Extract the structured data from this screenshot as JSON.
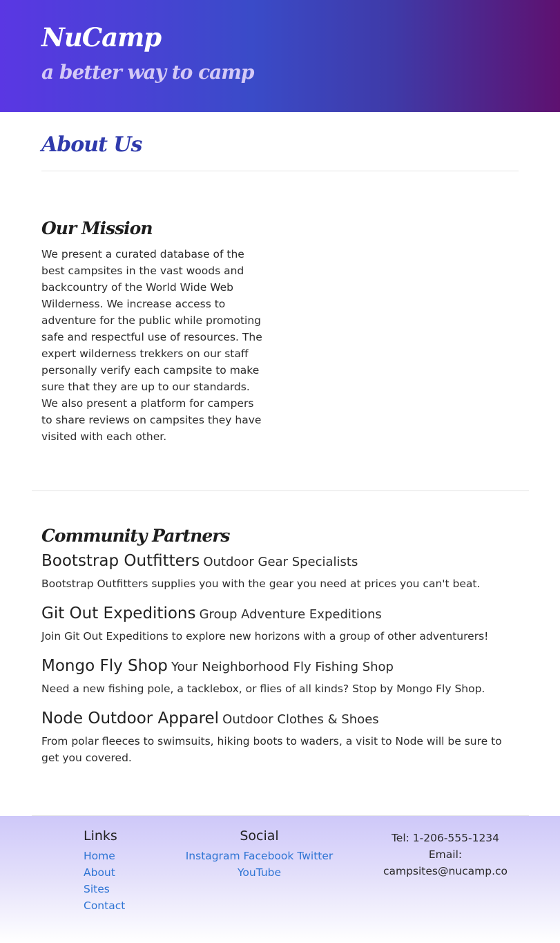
{
  "header": {
    "brand": "NuCamp",
    "tagline": "a better way to camp"
  },
  "main": {
    "title": "About Us",
    "mission": {
      "heading": "Our Mission",
      "text": "We present a curated database of the best campsites in the vast woods and backcountry of the World Wide Web Wilderness. We increase access to adventure for the public while promoting safe and respectful use of resources. The expert wilderness trekkers on our staff personally verify each campsite to make sure that they are up to our standards. We also present a platform for campers to share reviews on campsites they have visited with each other."
    },
    "partners": {
      "heading": "Community Partners",
      "items": [
        {
          "name": "Bootstrap Outfitters",
          "tagline": "Outdoor Gear Specialists",
          "description": "Bootstrap Outfitters supplies you with the gear you need at prices you can't beat."
        },
        {
          "name": "Git Out Expeditions",
          "tagline": "Group Adventure Expeditions",
          "description": "Join Git Out Expeditions to explore new horizons with a group of other adventurers!"
        },
        {
          "name": "Mongo Fly Shop",
          "tagline": "Your Neighborhood Fly Fishing Shop",
          "description": "Need a new fishing pole, a tacklebox, or flies of all kinds? Stop by Mongo Fly Shop."
        },
        {
          "name": "Node Outdoor Apparel",
          "tagline": "Outdoor Clothes & Shoes",
          "description": "From polar fleeces to swimsuits, hiking boots to waders, a visit to Node will be sure to get you covered."
        }
      ]
    }
  },
  "footer": {
    "links": {
      "heading": "Links",
      "items": [
        "Home",
        "About",
        "Sites",
        "Contact"
      ]
    },
    "social": {
      "heading": "Social",
      "items": [
        "Instagram",
        "Facebook",
        "Twitter",
        "YouTube"
      ]
    },
    "contact": {
      "tel": "Tel: 1-206-555-1234",
      "email_label": "Email:",
      "email": "campsites@nucamp.co"
    }
  },
  "colors": {
    "header_gradient_start": "#5a37e3",
    "header_gradient_end": "#5e1170",
    "title_blue": "#2f3aac",
    "link_blue": "#2e74d4",
    "footer_lavender": "#cec8f9"
  }
}
